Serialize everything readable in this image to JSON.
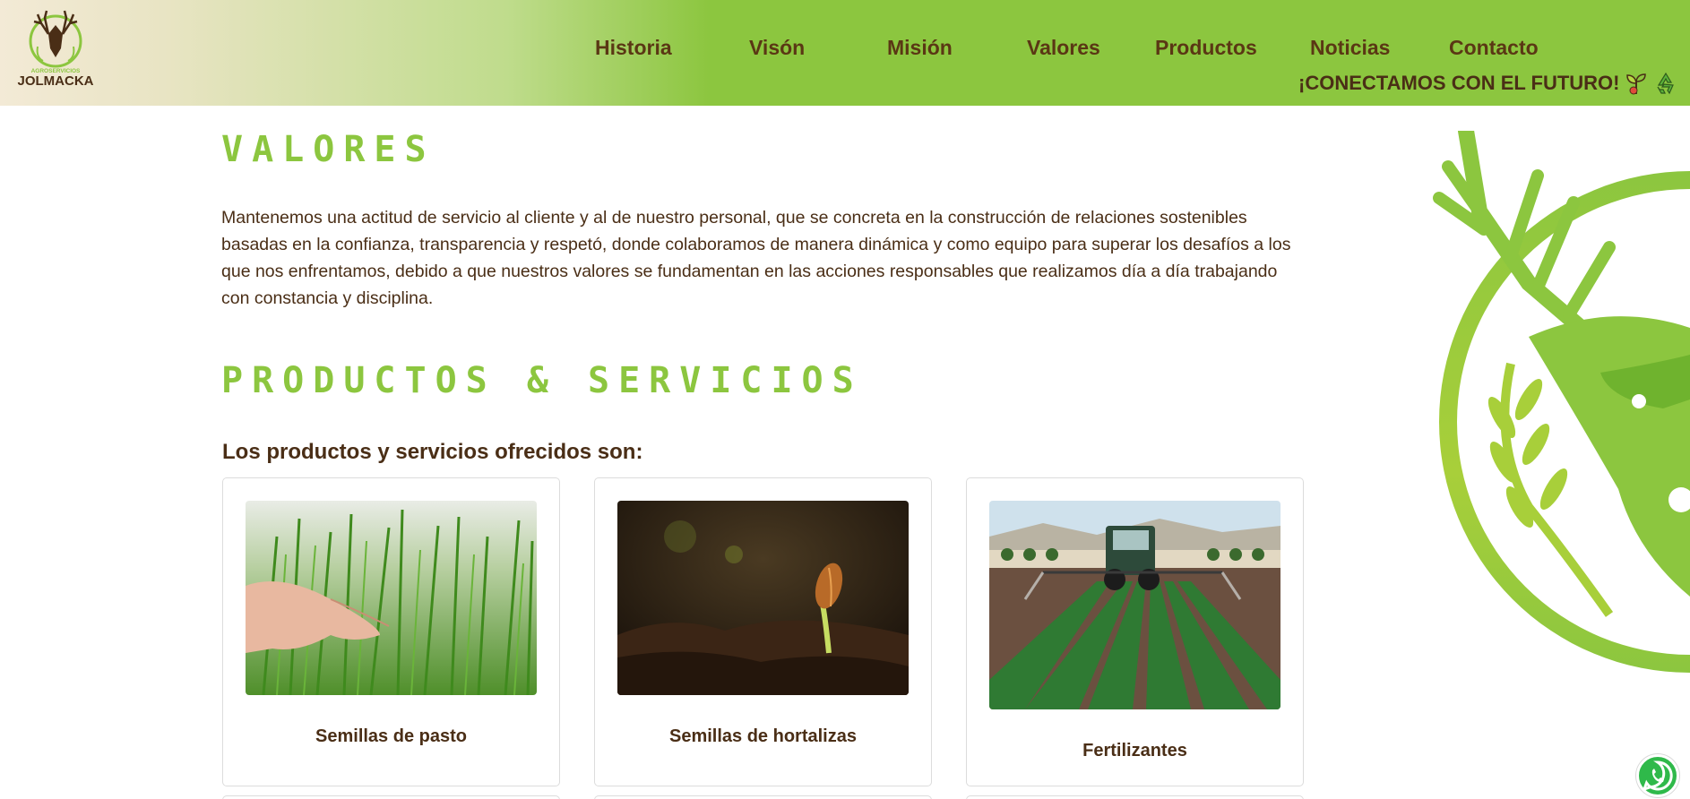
{
  "brand": {
    "small_text": "AGROSERVICIOS",
    "name": "JOLMACKA"
  },
  "nav": [
    {
      "label": "Historia"
    },
    {
      "label": "Visón"
    },
    {
      "label": "Misión"
    },
    {
      "label": "Valores"
    },
    {
      "label": "Productos"
    },
    {
      "label": "Noticias"
    },
    {
      "label": "Contacto"
    }
  ],
  "tagline": "¡CONECTAMOS CON EL FUTURO!",
  "tagline_icons": [
    "sprout-icon",
    "recycle-icon"
  ],
  "valores": {
    "title": "VALORES",
    "text": "Mantenemos una actitud de servicio al cliente y al de nuestro personal, que se concreta en la construcción de relaciones sostenibles basadas en la confianza, transparencia y respetó, donde colaboramos de manera dinámica y como equipo para superar los desafíos a los que nos enfrentamos, debido a que nuestros valores se fundamentan en las acciones responsables que realizamos día a día trabajando con constancia y disciplina."
  },
  "productos": {
    "title": "PRODUCTOS & SERVICIOS",
    "subtitle": "Los productos y servicios ofrecidos son:",
    "cards": [
      {
        "title": "Semillas de pasto"
      },
      {
        "title": "Semillas de hortalizas"
      },
      {
        "title": "Fertilizantes"
      }
    ]
  },
  "colors": {
    "accent_green": "#8cc63f",
    "brown_text": "#4a2e16",
    "whatsapp_green": "#2fb94a"
  }
}
